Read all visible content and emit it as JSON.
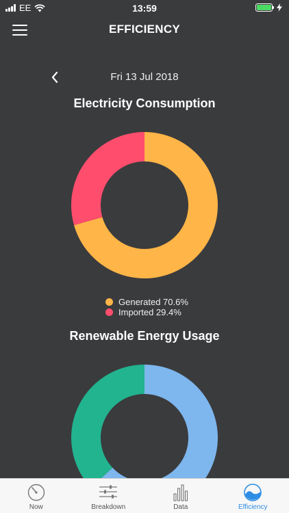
{
  "status": {
    "carrier": "EE",
    "time": "13:59"
  },
  "header": {
    "title": "EFFICIENCY"
  },
  "date_nav": {
    "date": "Fri 13 Jul 2018"
  },
  "charts": {
    "consumption": {
      "title": "Electricity Consumption"
    },
    "renewable": {
      "title": "Renewable Energy Usage"
    }
  },
  "chart_data": [
    {
      "type": "pie",
      "title": "Electricity Consumption",
      "series": [
        {
          "name": "Generated 70.6%",
          "value": 70.6,
          "color": "#ffb547"
        },
        {
          "name": "Imported 29.4%",
          "value": 29.4,
          "color": "#ff4d6d"
        }
      ]
    },
    {
      "type": "pie",
      "title": "Renewable Energy Usage",
      "series": [
        {
          "value": 63,
          "color": "#7eb6ee"
        },
        {
          "value": 37,
          "color": "#22b38f"
        }
      ]
    }
  ],
  "tabs": [
    {
      "label": "Now",
      "icon": "gauge-icon"
    },
    {
      "label": "Breakdown",
      "icon": "sliders-icon"
    },
    {
      "label": "Data",
      "icon": "bar-chart-icon"
    },
    {
      "label": "Efficiency",
      "icon": "wave-icon",
      "active": true
    }
  ],
  "colors": {
    "background": "#3a3b3d",
    "accent": "#2e8de4"
  }
}
